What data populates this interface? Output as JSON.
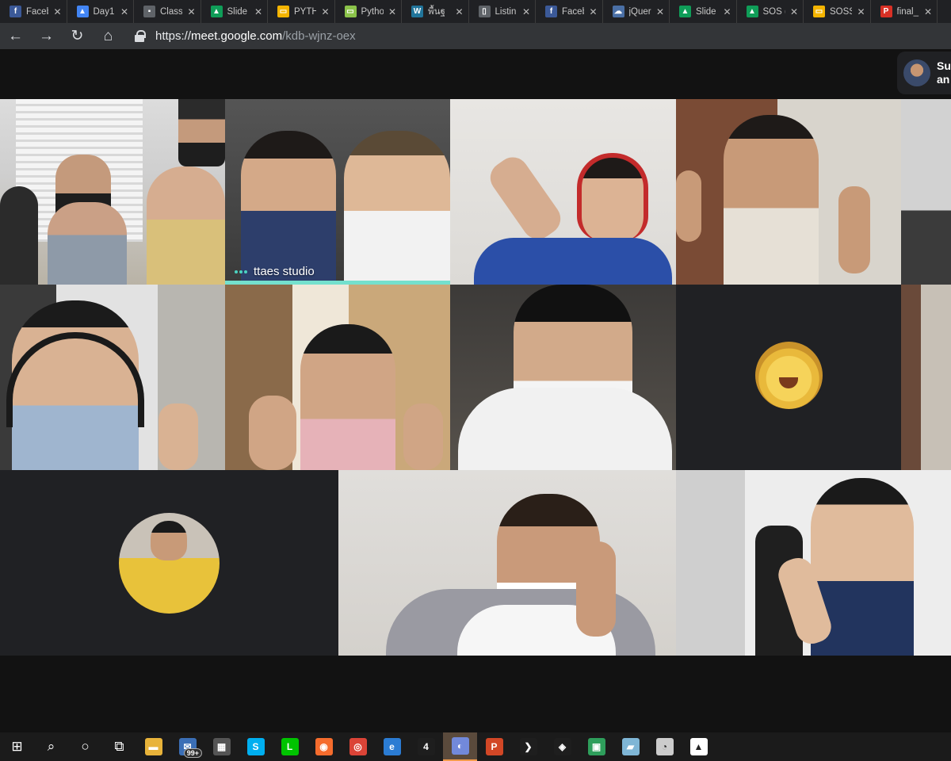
{
  "browser": {
    "tabs": [
      {
        "title": "Faceb",
        "icon": "facebook-icon",
        "color": "#3b5998",
        "glyph": "f"
      },
      {
        "title": "Day1",
        "icon": "person-icon",
        "color": "#4285f4",
        "glyph": "▲"
      },
      {
        "title": "Class",
        "icon": "classroom-icon",
        "color": "#5f6368",
        "glyph": "▪"
      },
      {
        "title": "Slide",
        "icon": "drive-icon",
        "color": "#0f9d58",
        "glyph": "▲"
      },
      {
        "title": "PYTH",
        "icon": "slides-icon",
        "color": "#f4b400",
        "glyph": "▭"
      },
      {
        "title": "Pytho",
        "icon": "python-icon",
        "color": "#8bc34a",
        "glyph": "▭"
      },
      {
        "title": "พื้นฐ",
        "icon": "wordpress-icon",
        "color": "#21759b",
        "glyph": "W"
      },
      {
        "title": "Listin",
        "icon": "document-icon",
        "color": "#5f6368",
        "glyph": "▯"
      },
      {
        "title": "Faceb",
        "icon": "facebook-icon",
        "color": "#3b5998",
        "glyph": "f"
      },
      {
        "title": "jQuer",
        "icon": "cloud-icon",
        "color": "#4a6fa5",
        "glyph": "☁"
      },
      {
        "title": "Slide",
        "icon": "drive-icon",
        "color": "#0f9d58",
        "glyph": "▲"
      },
      {
        "title": "SOS (",
        "icon": "drive-icon",
        "color": "#0f9d58",
        "glyph": "▲"
      },
      {
        "title": "SOSS",
        "icon": "slides-icon",
        "color": "#f4b400",
        "glyph": "▭"
      },
      {
        "title": "final_",
        "icon": "pdf-icon",
        "color": "#d93025",
        "glyph": "P"
      }
    ],
    "close_glyph": "✕",
    "nav": {
      "back": "←",
      "forward": "→",
      "reload": "↻",
      "home": "⌂"
    },
    "url": {
      "scheme": "https://",
      "host": "meet.google.com",
      "path": "/kdb-wjnz-oex"
    }
  },
  "meet": {
    "presenter": {
      "name_line1": "Su",
      "name_line2": "an"
    },
    "speaking_tile_label": "ttaes studio"
  },
  "taskbar": {
    "items": [
      {
        "icon": "windows-start-icon",
        "color": "transparent",
        "glyph": "⊞"
      },
      {
        "icon": "search-icon",
        "color": "transparent",
        "glyph": "⌕"
      },
      {
        "icon": "cortana-icon",
        "color": "transparent",
        "glyph": "○"
      },
      {
        "icon": "task-view-icon",
        "color": "transparent",
        "glyph": "⧉"
      },
      {
        "icon": "file-explorer-icon",
        "color": "#e8b33a",
        "glyph": "▬"
      },
      {
        "icon": "mail-icon",
        "color": "#3b6fb6",
        "glyph": "✉",
        "badge": "99+"
      },
      {
        "icon": "store-icon",
        "color": "#555555",
        "glyph": "▦"
      },
      {
        "icon": "skype-icon",
        "color": "#00aff0",
        "glyph": "S"
      },
      {
        "icon": "line-icon",
        "color": "#00c300",
        "glyph": "L"
      },
      {
        "icon": "origin-icon",
        "color": "#f56c2d",
        "glyph": "◉"
      },
      {
        "icon": "chrome-icon",
        "color": "#db4437",
        "glyph": "◎"
      },
      {
        "icon": "edge-icon",
        "color": "#2b7cd3",
        "glyph": "e"
      },
      {
        "icon": "app-4-icon",
        "color": "#1e1e1e",
        "glyph": "4"
      },
      {
        "icon": "discord-icon",
        "color": "#7289da",
        "glyph": "◐",
        "active": true
      },
      {
        "icon": "powerpoint-icon",
        "color": "#d24726",
        "glyph": "P"
      },
      {
        "icon": "vscode-icon",
        "color": "#1e1e1e",
        "glyph": "❯"
      },
      {
        "icon": "garena-icon",
        "color": "#1e1e1e",
        "glyph": "◈"
      },
      {
        "icon": "gallery-icon",
        "color": "#2e9e5b",
        "glyph": "▣"
      },
      {
        "icon": "notes-icon",
        "color": "#7fb6d6",
        "glyph": "▰"
      },
      {
        "icon": "paint-icon",
        "color": "#cccccc",
        "glyph": "◔"
      },
      {
        "icon": "photos-icon",
        "color": "#ffffff",
        "glyph": "▲"
      }
    ]
  }
}
